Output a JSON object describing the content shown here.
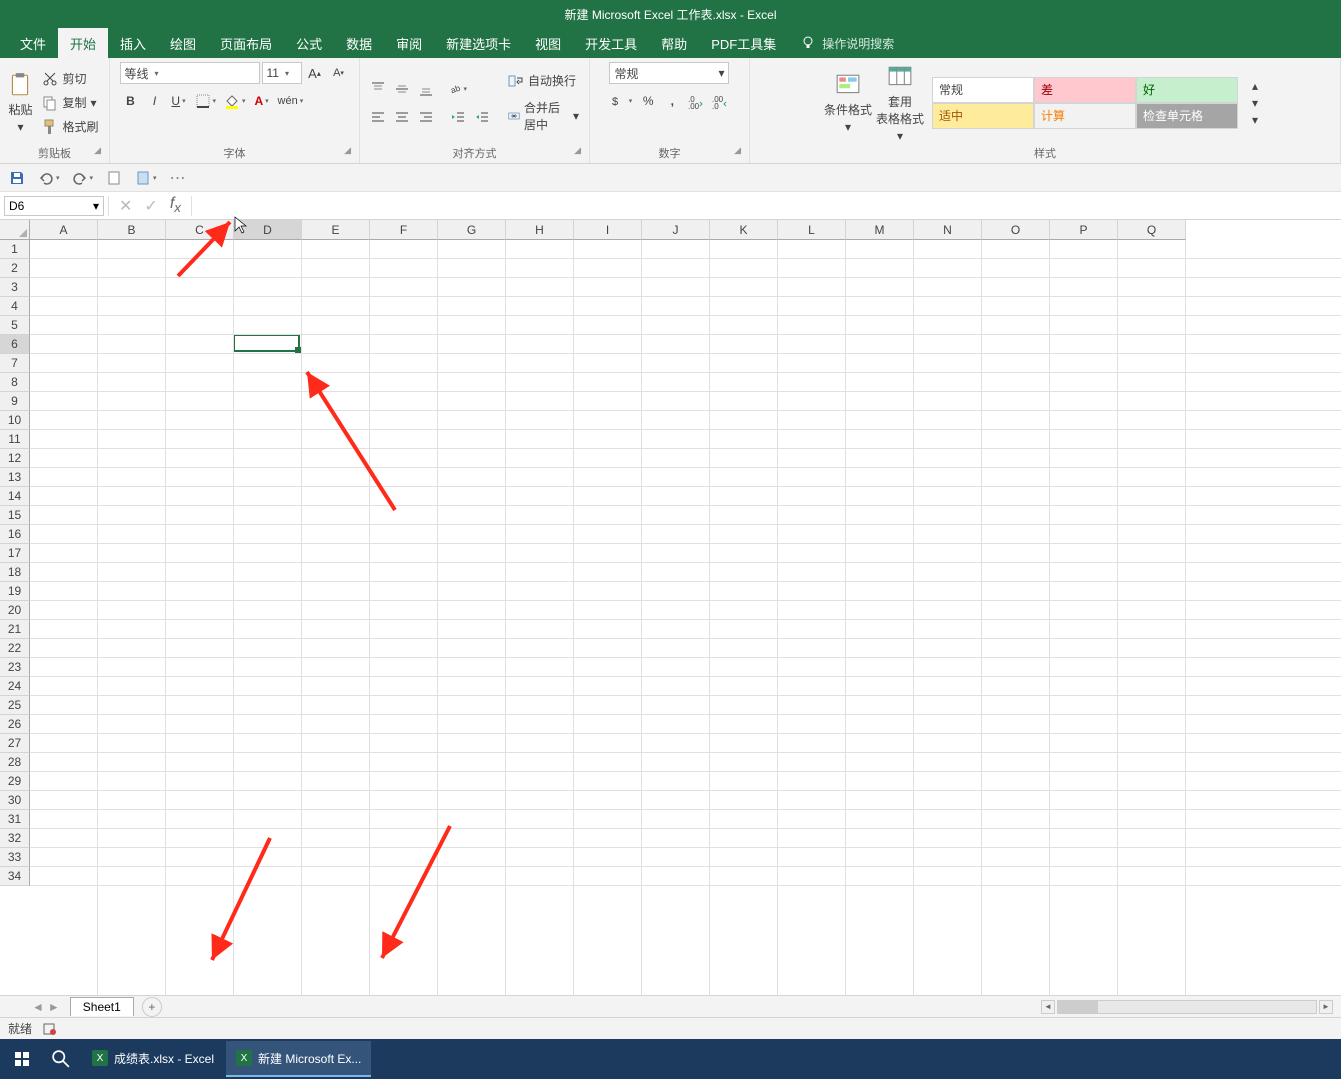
{
  "title": "新建 Microsoft Excel 工作表.xlsx  -  Excel",
  "tabs": [
    "文件",
    "开始",
    "插入",
    "绘图",
    "页面布局",
    "公式",
    "数据",
    "审阅",
    "新建选项卡",
    "视图",
    "开发工具",
    "帮助",
    "PDF工具集"
  ],
  "active_tab_index": 1,
  "tellme": "操作说明搜索",
  "clipboard": {
    "paste": "粘贴",
    "cut": "剪切",
    "copy": "复制",
    "format_painter": "格式刷",
    "group": "剪贴板"
  },
  "font": {
    "name": "等线",
    "size": "11",
    "group": "字体"
  },
  "alignment": {
    "wrap": "自动换行",
    "merge": "合并后居中",
    "group": "对齐方式"
  },
  "number": {
    "format": "常规",
    "group": "数字"
  },
  "styles": {
    "cond": "条件格式",
    "table": "套用\n表格格式",
    "normal": "常规",
    "bad": "差",
    "good": "好",
    "neutral": "适中",
    "calc": "计算",
    "check": "检查单元格",
    "group": "样式"
  },
  "name_box": "D6",
  "columns": [
    "A",
    "B",
    "C",
    "D",
    "E",
    "F",
    "G",
    "H",
    "I",
    "J",
    "K",
    "L",
    "M",
    "N",
    "O",
    "P",
    "Q"
  ],
  "row_count": 34,
  "active": {
    "col_index": 3,
    "row_index": 5
  },
  "sheet": {
    "name": "Sheet1"
  },
  "status": {
    "ready": "就绪"
  },
  "taskbar": {
    "app1": "成绩表.xlsx - Excel",
    "app2": "新建 Microsoft Ex..."
  }
}
